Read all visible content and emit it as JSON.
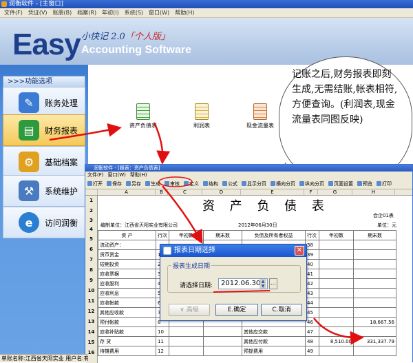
{
  "window": {
    "title": "润衡软件 - [主窗口]"
  },
  "menu": [
    "文件(F)",
    "凭证(V)",
    "账册(B)",
    "档案(R)",
    "年初(I)",
    "系统(S)",
    "窗口(W)",
    "帮助(H)"
  ],
  "hero": {
    "brand": "Easy",
    "cn": "小快记",
    "version": "2.0",
    "edition": "「个人版」",
    "en": "Accounting Software"
  },
  "sidebar": {
    "header": ">>>功能选项",
    "items": [
      {
        "label": "账务处理",
        "icon": "ledger-icon"
      },
      {
        "label": "财务报表",
        "icon": "reports-icon"
      },
      {
        "label": "基础档案",
        "icon": "gears-icon"
      },
      {
        "label": "系统维护",
        "icon": "tools-icon"
      },
      {
        "label": "访问润衡",
        "icon": "internet-icon"
      }
    ]
  },
  "reports": [
    {
      "label": "资产负债表",
      "icon": "balance-sheet-icon"
    },
    {
      "label": "利润表",
      "icon": "income-statement-icon"
    },
    {
      "label": "现金流量表",
      "icon": "cash-flow-icon"
    }
  ],
  "bubble": "记账之后,财务报表即刻生成,无需结账,帐表相符,方便查询。(利润表,现金流量表同图反映)",
  "sub": {
    "title": "润衡软件 - [报表：资产负债表]",
    "menu": [
      "文件(F)",
      "窗口(W)",
      "帮助(H)"
    ],
    "toolbar": [
      "打开",
      "保存",
      "另存",
      "生成",
      "审核",
      "定义",
      "结构",
      "公式",
      "显示分页",
      "横向分页",
      "纵向分页",
      "页面设置",
      "预览",
      "打印"
    ],
    "cols": [
      "A",
      "B",
      "C",
      "D",
      "E",
      "F",
      "G",
      "H"
    ],
    "sheet_title": "资 产 负 债 表",
    "form_no": "会企01表",
    "company": "编制单位：江西省天阳实业有限公司",
    "date": "2012年06月30日",
    "unit": "单位：元",
    "headers": [
      "资 产",
      "行次",
      "年初数",
      "期末数",
      "负债及所有者权益",
      "行次",
      "年初数",
      "期末数"
    ],
    "rows": [
      {
        "n": "5",
        "a": "流动资产：",
        "r": "",
        "e": "",
        "rr": "38"
      },
      {
        "n": "6",
        "a": "货币资金",
        "r": "1",
        "e": "",
        "rr": "39"
      },
      {
        "n": "7",
        "a": "短期投资",
        "r": "2",
        "e": "",
        "rr": "40"
      },
      {
        "n": "8",
        "a": "应收票据",
        "r": "3",
        "e": "",
        "rr": "41"
      },
      {
        "n": "9",
        "a": "应收股利",
        "r": "4",
        "e": "",
        "rr": "42"
      },
      {
        "n": "10",
        "a": "应收利息",
        "r": "5",
        "e": "",
        "rr": "43"
      },
      {
        "n": "11",
        "a": "应收帐款",
        "r": "6",
        "e": "",
        "rr": "44"
      },
      {
        "n": "12",
        "a": "其他应收款",
        "r": "7",
        "e": "",
        "rr": "45"
      },
      {
        "n": "13",
        "a": "预付帐款",
        "r": "8",
        "e": "",
        "rr": "46",
        "h": "18,667.56"
      },
      {
        "n": "14",
        "a": "应收补贴款",
        "r": "10",
        "e": "其他应交款",
        "rr": "47"
      },
      {
        "n": "15",
        "a": "存  货",
        "r": "11",
        "e": "其他应付款",
        "rr": "48",
        "g": "8,510.00",
        "h": "331,337.79"
      },
      {
        "n": "16",
        "a": "待摊费用",
        "r": "12",
        "e": "预提费用",
        "rr": "49"
      }
    ]
  },
  "dialog": {
    "title": "报表日期选择",
    "group": "报表生成日期",
    "label": "请选择日期:",
    "value": "2012.06.30",
    "advanced": "高级",
    "ok": "E.确定",
    "cancel": "C.取消"
  },
  "status": "单账名称:江西省天阳实业    用户名:有"
}
